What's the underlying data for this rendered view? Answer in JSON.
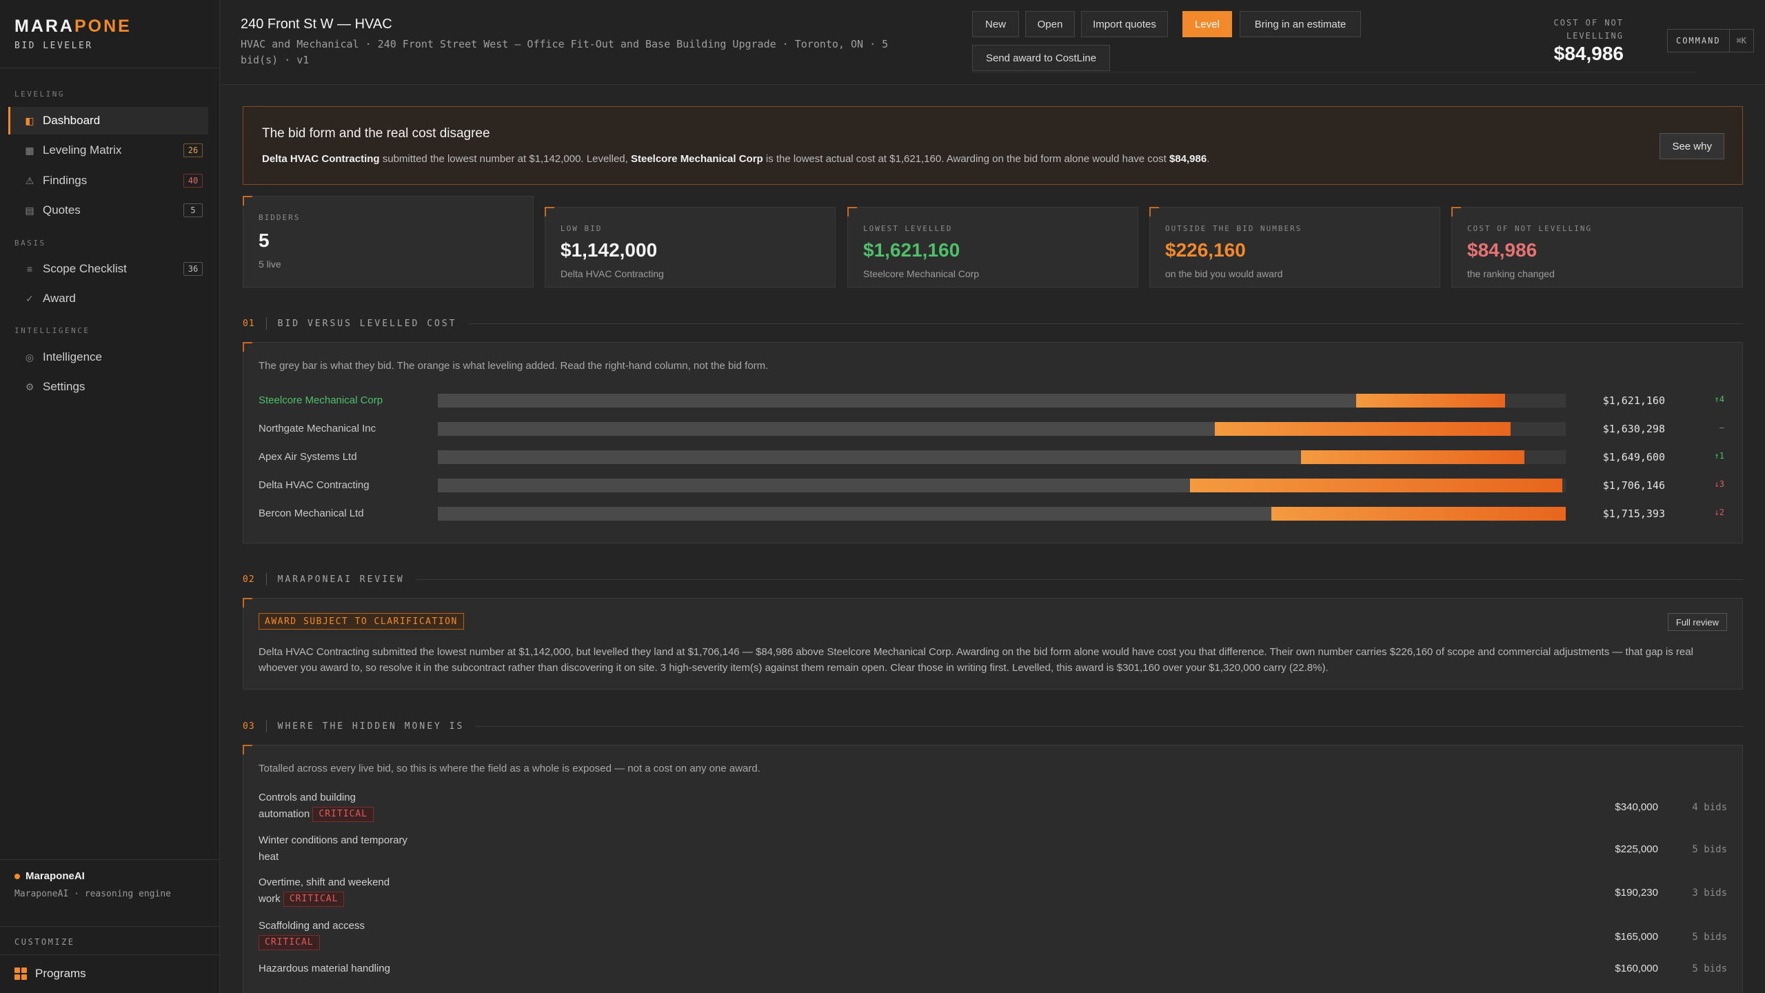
{
  "brand": {
    "logo_a": "MARA",
    "logo_b": "PONE",
    "sub": "BID LEVELER"
  },
  "nav": {
    "sec_leveling": "LEVELING",
    "sec_basis": "BASIS",
    "sec_intel": "INTELLIGENCE",
    "dashboard": "Dashboard",
    "matrix": "Leveling Matrix",
    "matrix_badge": "26",
    "findings": "Findings",
    "findings_badge": "40",
    "quotes": "Quotes",
    "quotes_badge": "5",
    "scope": "Scope Checklist",
    "scope_badge": "36",
    "award": "Award",
    "intelligence": "Intelligence",
    "settings": "Settings"
  },
  "ai": {
    "title": "MaraponeAI",
    "sub": "MaraponeAI · reasoning engine"
  },
  "customize": "CUSTOMIZE",
  "programs": "Programs",
  "header": {
    "title": "240 Front St W — HVAC",
    "subtitle": "HVAC and Mechanical · 240 Front Street West — Office Fit-Out and Base Building Upgrade · Toronto, ON · 5 bid(s) · v1",
    "btn_new": "New",
    "btn_open": "Open",
    "btn_import": "Import quotes",
    "btn_level": "Level",
    "btn_estimate": "Bring in an estimate",
    "btn_send": "Send award to CostLine",
    "cost_label": "COST OF NOT LEVELLING",
    "cost_value": "$84,986",
    "cmd": "COMMAND",
    "cmd_key": "⌘K"
  },
  "alert": {
    "title": "The bid form and the real cost disagree",
    "b1": "Delta HVAC Contracting",
    "t1": " submitted the lowest number at $1,142,000. Levelled, ",
    "b2": "Steelcore Mechanical Corp",
    "t2": " is the lowest actual cost at $1,621,160. Awarding on the bid form alone would have cost ",
    "b3": "$84,986",
    "t3": ".",
    "button": "See why"
  },
  "cards": [
    {
      "label": "BIDDERS",
      "value": "5",
      "sub": "5 live",
      "color": "#f4f4f4"
    },
    {
      "label": "LOW BID",
      "value": "$1,142,000",
      "sub": "Delta HVAC Contracting",
      "color": "#f4f4f4"
    },
    {
      "label": "LOWEST LEVELLED",
      "value": "$1,621,160",
      "sub": "Steelcore Mechanical Corp",
      "color": "#4ec06a"
    },
    {
      "label": "OUTSIDE THE BID NUMBERS",
      "value": "$226,160",
      "sub": "on the bid you would award",
      "color": "#f28a2b"
    },
    {
      "label": "COST OF NOT LEVELLING",
      "value": "$84,986",
      "sub": "the ranking changed",
      "color": "#e57373"
    }
  ],
  "sections": {
    "s1_num": "01",
    "s1_title": "BID VERSUS LEVELLED COST",
    "s2_num": "02",
    "s2_title": "MARAPONEAI REVIEW",
    "s3_num": "03",
    "s3_title": "WHERE THE HIDDEN MONEY IS"
  },
  "chart_data": {
    "type": "bar",
    "note": "The grey bar is what they bid. The orange is what leveling added. Read the right-hand column, not the bid form.",
    "rows": [
      {
        "name": "Steelcore Mechanical Corp",
        "bid_frac": 0.814,
        "levelled_frac": 0.946,
        "value": "$1,621,160",
        "delta": "↑4",
        "dir": "up",
        "best": true
      },
      {
        "name": "Northgate Mechanical Inc",
        "bid_frac": 0.689,
        "levelled_frac": 0.951,
        "value": "$1,630,298",
        "delta": "—",
        "dir": "flat",
        "best": false
      },
      {
        "name": "Apex Air Systems Ltd",
        "bid_frac": 0.765,
        "levelled_frac": 0.963,
        "value": "$1,649,600",
        "delta": "↑1",
        "dir": "up",
        "best": false
      },
      {
        "name": "Delta HVAC Contracting",
        "bid_frac": 0.667,
        "levelled_frac": 0.997,
        "value": "$1,706,146",
        "delta": "↓3",
        "dir": "down",
        "best": false
      },
      {
        "name": "Bercon Mechanical Ltd",
        "bid_frac": 0.739,
        "levelled_frac": 1.0,
        "value": "$1,715,393",
        "delta": "↓2",
        "dir": "down",
        "best": false
      }
    ]
  },
  "review": {
    "tag": "AWARD SUBJECT TO CLARIFICATION",
    "button": "Full review",
    "text": "Delta HVAC Contracting submitted the lowest number at $1,142,000, but levelled they land at $1,706,146 — $84,986 above Steelcore Mechanical Corp. Awarding on the bid form alone would have cost you that difference. Their own number carries $226,160 of scope and commercial adjustments — that gap is real whoever you award to, so resolve it in the subcontract rather than discovering it on site. 3 high-severity item(s) against them remain open. Clear those in writing first. Levelled, this award is $301,160 over your $1,320,000 carry (22.8%)."
  },
  "hidden": {
    "note": "Totalled across every live bid, so this is where the field as a whole is exposed — not a cost on any one award.",
    "critical": "CRITICAL",
    "rows": [
      {
        "l1": "Controls and building",
        "l2": "automation",
        "amount": "$340,000",
        "bids": "4 bids"
      },
      {
        "l1": "Winter conditions and temporary",
        "l2": "heat",
        "amount": "$225,000",
        "bids": "5 bids"
      },
      {
        "l1": "Overtime, shift and weekend",
        "l2": "work",
        "amount": "$190,230",
        "bids": "3 bids"
      },
      {
        "l1": "Scaffolding and access",
        "l2": "",
        "amount": "$165,000",
        "bids": "5 bids"
      },
      {
        "l1": "Hazardous material handling",
        "l2": "",
        "amount": "$160,000",
        "bids": "5 bids"
      }
    ]
  }
}
